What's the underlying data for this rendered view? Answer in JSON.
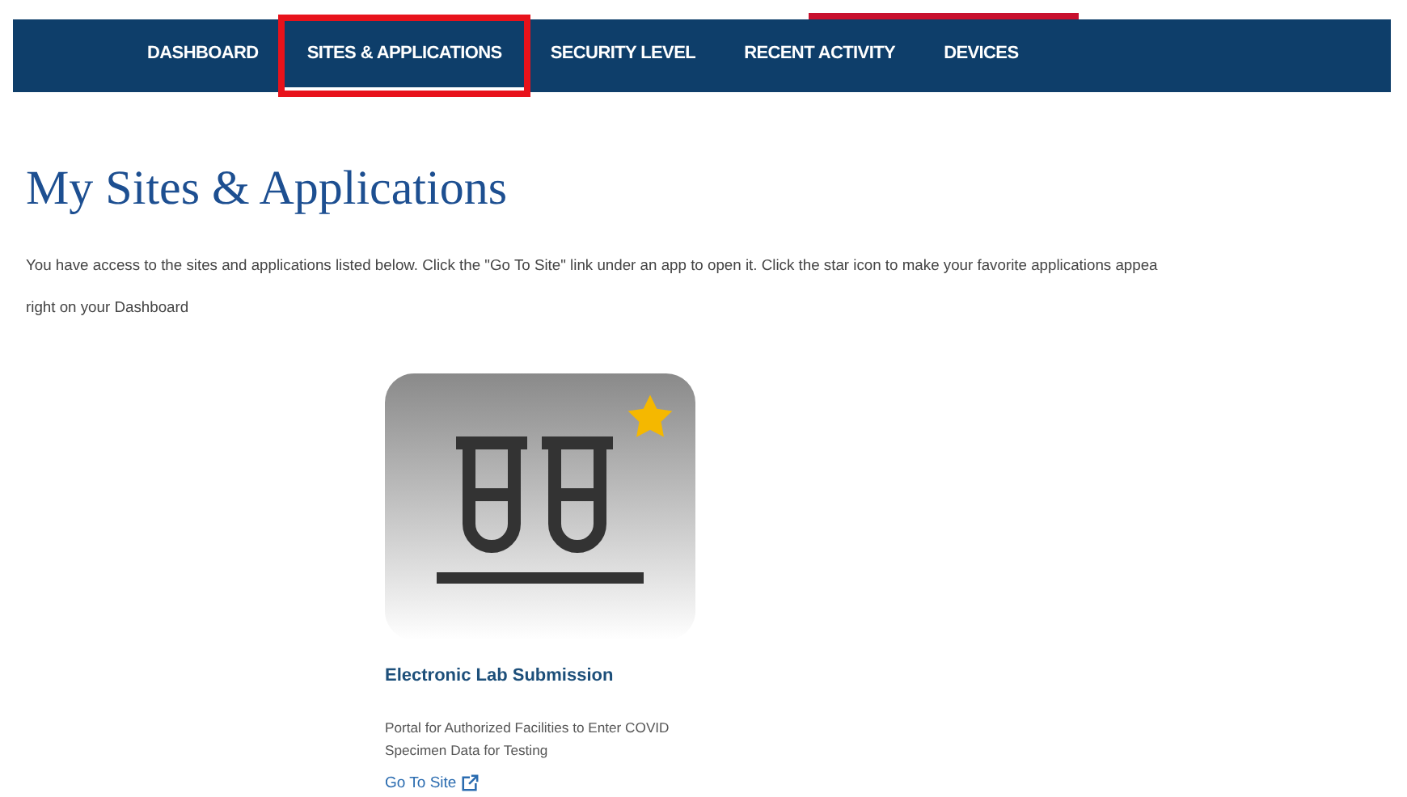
{
  "nav": {
    "tabs": [
      {
        "label": "DASHBOARD",
        "selected": false,
        "annotated": false
      },
      {
        "label": "SITES & APPLICATIONS",
        "selected": true,
        "annotated": true
      },
      {
        "label": "SECURITY LEVEL",
        "selected": false,
        "annotated": false
      },
      {
        "label": "RECENT ACTIVITY",
        "selected": false,
        "annotated": false
      },
      {
        "label": "DEVICES",
        "selected": false,
        "annotated": false
      }
    ]
  },
  "page": {
    "title": "My Sites & Applications",
    "description_lines": [
      "You have access to the sites and applications listed below. Click the \"Go To Site\" link under an app to open it. Click the star icon to make your favorite applications appea",
      "right on your Dashboard"
    ]
  },
  "apps": [
    {
      "name": "Electronic Lab Submission",
      "favorite": true,
      "description": "Portal for Authorized Facilities to Enter COVID Specimen Data for Testing",
      "link": "Go To Site"
    }
  ]
}
